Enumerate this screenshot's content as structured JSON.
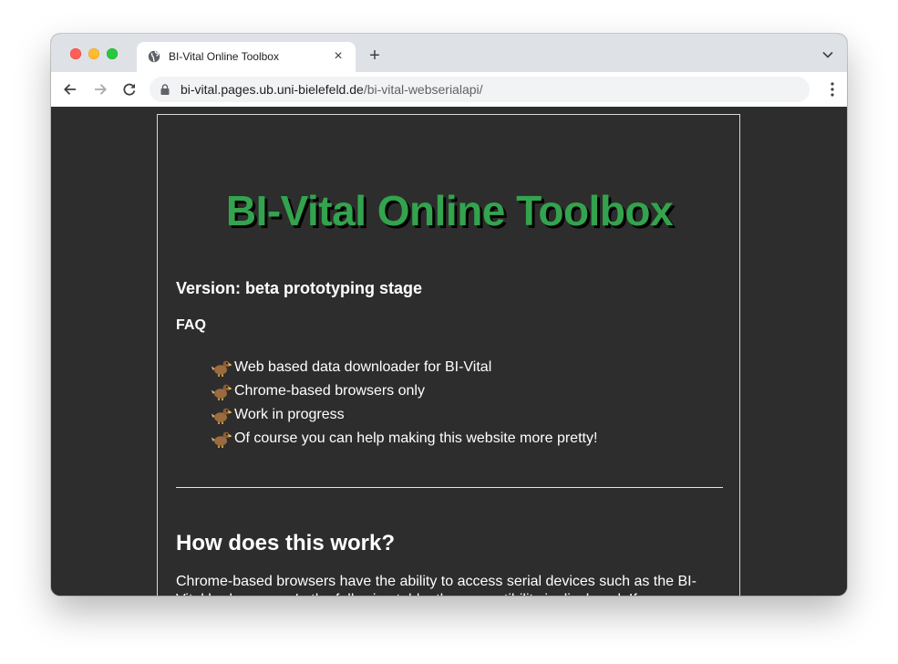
{
  "browser": {
    "tab": {
      "title": "BI-Vital Online Toolbox",
      "favicon": "globe-icon",
      "close": "×"
    },
    "new_tab": "+",
    "address": {
      "host": "bi-vital.pages.ub.uni-bielefeld.de",
      "path": "/bi-vital-webserialapi/"
    }
  },
  "page": {
    "title": "BI-Vital Online Toolbox",
    "title_color": "#33a34e",
    "version": "Version: beta prototyping stage",
    "faq_heading": "FAQ",
    "faq_items": [
      "Web based data downloader for BI-Vital",
      "Chrome-based browsers only",
      "Work in progress",
      "Of course you can help making this website more pretty!"
    ],
    "section_heading": "How does this work?",
    "section_text": "Chrome-based browsers have the ability to access serial devices such as the BI-Vital body sensor. In the following table, the compatibility is displayed. If your"
  }
}
